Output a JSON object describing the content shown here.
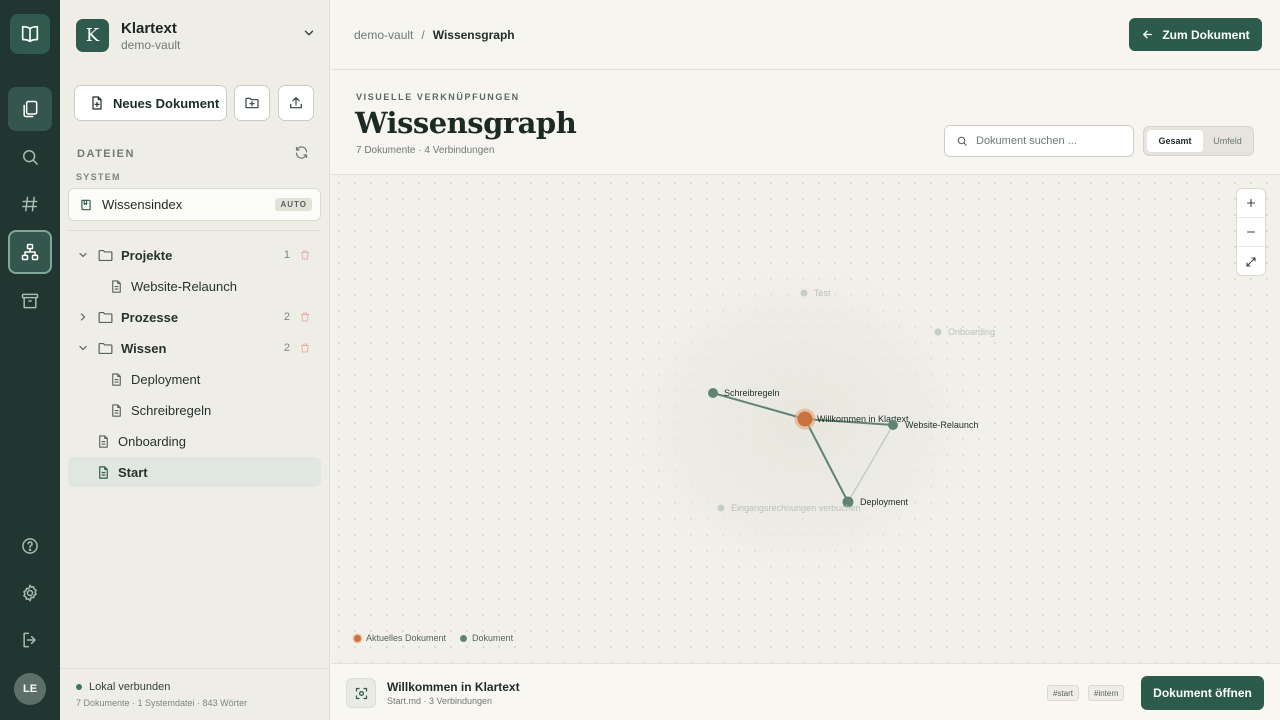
{
  "rail": {
    "avatar_initials": "LE",
    "icons": [
      "book-logo-icon",
      "documents-icon",
      "search-icon",
      "hashtag-icon",
      "graph-icon",
      "archive-icon",
      "help-icon",
      "settings-icon",
      "logout-icon"
    ]
  },
  "vault": {
    "initial": "K",
    "name": "Klartext",
    "subtitle": "demo-vault"
  },
  "sidebar": {
    "new_document_label": "Neues Dokument",
    "files_heading": "DATEIEN",
    "system_heading": "SYSTEM",
    "system_item": {
      "label": "Wissensindex",
      "badge": "AUTO"
    },
    "tree": [
      {
        "label": "Projekte",
        "count": "1"
      },
      {
        "label": "Website-Relaunch"
      },
      {
        "label": "Prozesse",
        "count": "2"
      },
      {
        "label": "Wissen",
        "count": "2"
      },
      {
        "label": "Deployment"
      },
      {
        "label": "Schreibregeln"
      },
      {
        "label": "Onboarding"
      },
      {
        "label": "Start"
      }
    ],
    "status": {
      "label": "Lokal verbunden",
      "meta": "7 Dokumente · 1 Systemdatei · 843 Wörter"
    }
  },
  "topbar": {
    "breadcrumb_root": "demo-vault",
    "breadcrumb_sep": "/",
    "breadcrumb_current": "Wissensgraph",
    "back_button": "Zum Dokument"
  },
  "header": {
    "eyebrow": "VISUELLE VERKNÜPFUNGEN",
    "title": "Wissensgraph",
    "subtitle": "7 Dokumente · 4 Verbindungen",
    "search_placeholder": "Dokument suchen ...",
    "toggle_all": "Gesamt",
    "toggle_local": "Umfeld"
  },
  "graph": {
    "nodes": [
      {
        "label": "Test",
        "state": "faded"
      },
      {
        "label": "Onboarding",
        "state": "faded"
      },
      {
        "label": "Schreibregeln",
        "state": "normal"
      },
      {
        "label": "Willkommen in Klartext",
        "state": "current"
      },
      {
        "label": "Website-Relaunch",
        "state": "normal"
      },
      {
        "label": "Deployment",
        "state": "normal"
      },
      {
        "label": "Eingangsrechnungen verbuchen",
        "state": "faded"
      }
    ],
    "links": [
      [
        "Willkommen in Klartext",
        "Schreibregeln"
      ],
      [
        "Willkommen in Klartext",
        "Website-Relaunch"
      ],
      [
        "Willkommen in Klartext",
        "Deployment"
      ],
      [
        "Website-Relaunch",
        "Deployment"
      ]
    ],
    "legend": {
      "current": "Aktuelles Dokument",
      "document": "Dokument"
    },
    "colors": {
      "current": "#c8733d",
      "document": "#5f8476",
      "link": "#5f8476"
    }
  },
  "footer": {
    "title": "Willkommen in Klartext",
    "subtitle": "Start.md · 3 Verbindungen",
    "tags": [
      "#start",
      "#intern"
    ],
    "open_button": "Dokument öffnen"
  }
}
